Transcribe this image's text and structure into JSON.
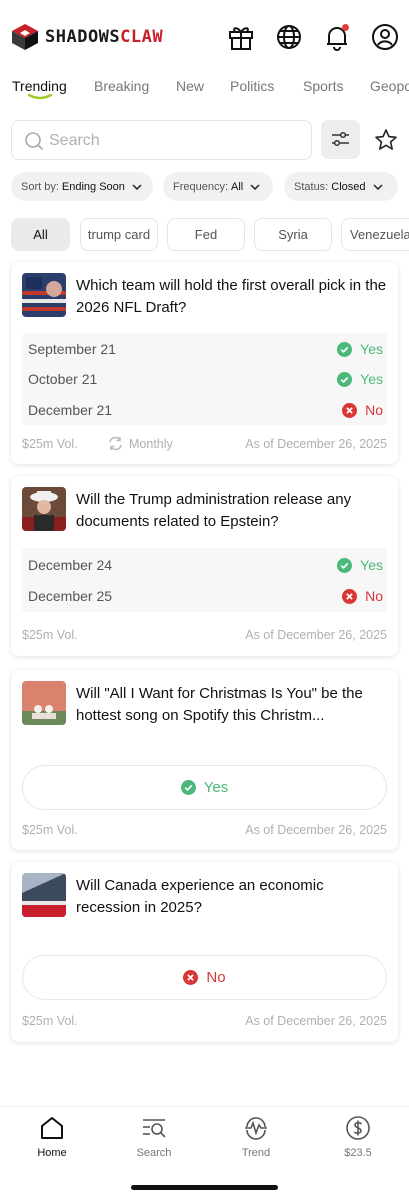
{
  "app": {
    "brand_part1": "SHADOWS",
    "brand_part2": "CLAW",
    "accent_color": "#c8202a"
  },
  "header_icons": [
    "gift-icon",
    "globe-icon",
    "bell-icon",
    "user-icon"
  ],
  "tabs": [
    {
      "label": "Trending",
      "active": true
    },
    {
      "label": "Breaking"
    },
    {
      "label": "New"
    },
    {
      "label": "Politics"
    },
    {
      "label": "Sports"
    },
    {
      "label": "Geopo"
    }
  ],
  "search": {
    "placeholder": "Search"
  },
  "filters": {
    "sort": {
      "prefix": "Sort by:",
      "value": "Ending Soon"
    },
    "frequency": {
      "prefix": "Frequency:",
      "value": "All"
    },
    "status": {
      "prefix": "Status:",
      "value": "Closed"
    }
  },
  "topics": [
    "All",
    "trump card",
    "Fed",
    "Syria",
    "Venezuela"
  ],
  "markets": [
    {
      "title": "Which team will hold the first overall pick in the 2026 NFL Draft?",
      "outcomes": [
        {
          "label": "September 21",
          "result": "Yes"
        },
        {
          "label": "October 21",
          "result": "Yes"
        },
        {
          "label": "December 21",
          "result": "No"
        }
      ],
      "volume": "$25m Vol.",
      "frequency": "Monthly",
      "as_of": "As of December 26, 2025"
    },
    {
      "title": "Will the Trump administration release any documents related to Epstein?",
      "outcomes": [
        {
          "label": "December 24",
          "result": "Yes"
        },
        {
          "label": "December 25",
          "result": "No"
        }
      ],
      "volume": "$25m Vol.",
      "as_of": "As of December 26, 2025"
    },
    {
      "title": "Will \"All I Want for Christmas Is You\" be the hottest song on Spotify this Christm...",
      "result": "Yes",
      "volume": "$25m Vol.",
      "as_of": "As of December 26, 2025"
    },
    {
      "title": "Will Canada experience an economic recession in 2025?",
      "result": "No",
      "volume": "$25m Vol.",
      "as_of": "As of December 26, 2025"
    }
  ],
  "colors": {
    "yes": "#4cb87a",
    "no": "#d93636"
  },
  "bottom_nav": [
    {
      "label": "Home",
      "icon": "home-icon",
      "active": true
    },
    {
      "label": "Search",
      "icon": "search-list-icon"
    },
    {
      "label": "Trend",
      "icon": "pulse-icon"
    },
    {
      "label": "$23.5",
      "icon": "dollar-icon"
    }
  ]
}
